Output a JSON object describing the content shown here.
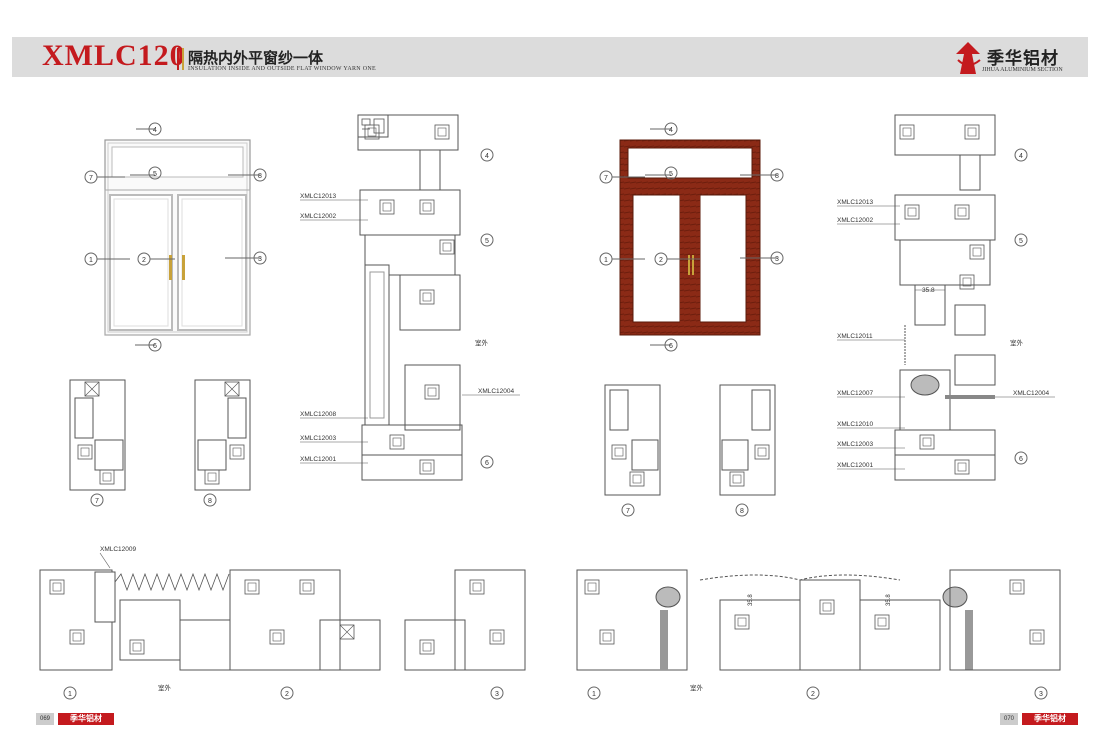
{
  "header": {
    "model": "XMLC120",
    "title_cn": "隔热内外平窗纱一体",
    "title_en": "INSULATION INSIDE AND OUTSIDE FLAT WINDOW YARN ONE",
    "brand_cn": "季华铝材",
    "brand_en": "JIHUA ALUMINIUM SECTION"
  },
  "callouts": [
    "1",
    "2",
    "3",
    "4",
    "5",
    "6",
    "7",
    "8"
  ],
  "left_section": {
    "codes": [
      "XMLC12013",
      "XMLC12002",
      "XMLC12008",
      "XMLC12003",
      "XMLC12001",
      "XMLC12004"
    ],
    "outside": "室外"
  },
  "right_section": {
    "codes": [
      "XMLC12013",
      "XMLC12002",
      "XMLC12011",
      "XMLC12007",
      "XMLC12010",
      "XMLC12003",
      "XMLC12001",
      "XMLC12004"
    ],
    "dimension": "35.8",
    "outside": "室外"
  },
  "plan_left": {
    "code": "XMLC12009",
    "outside": "室外"
  },
  "plan_right": {
    "dimension": "35.8",
    "outside": "室外"
  },
  "footer": {
    "page_left": "069",
    "page_right": "070",
    "logo": "季华铝材"
  },
  "colors": {
    "accent": "#c41a1e",
    "wood": "#8b2a16",
    "line": "#555555"
  }
}
